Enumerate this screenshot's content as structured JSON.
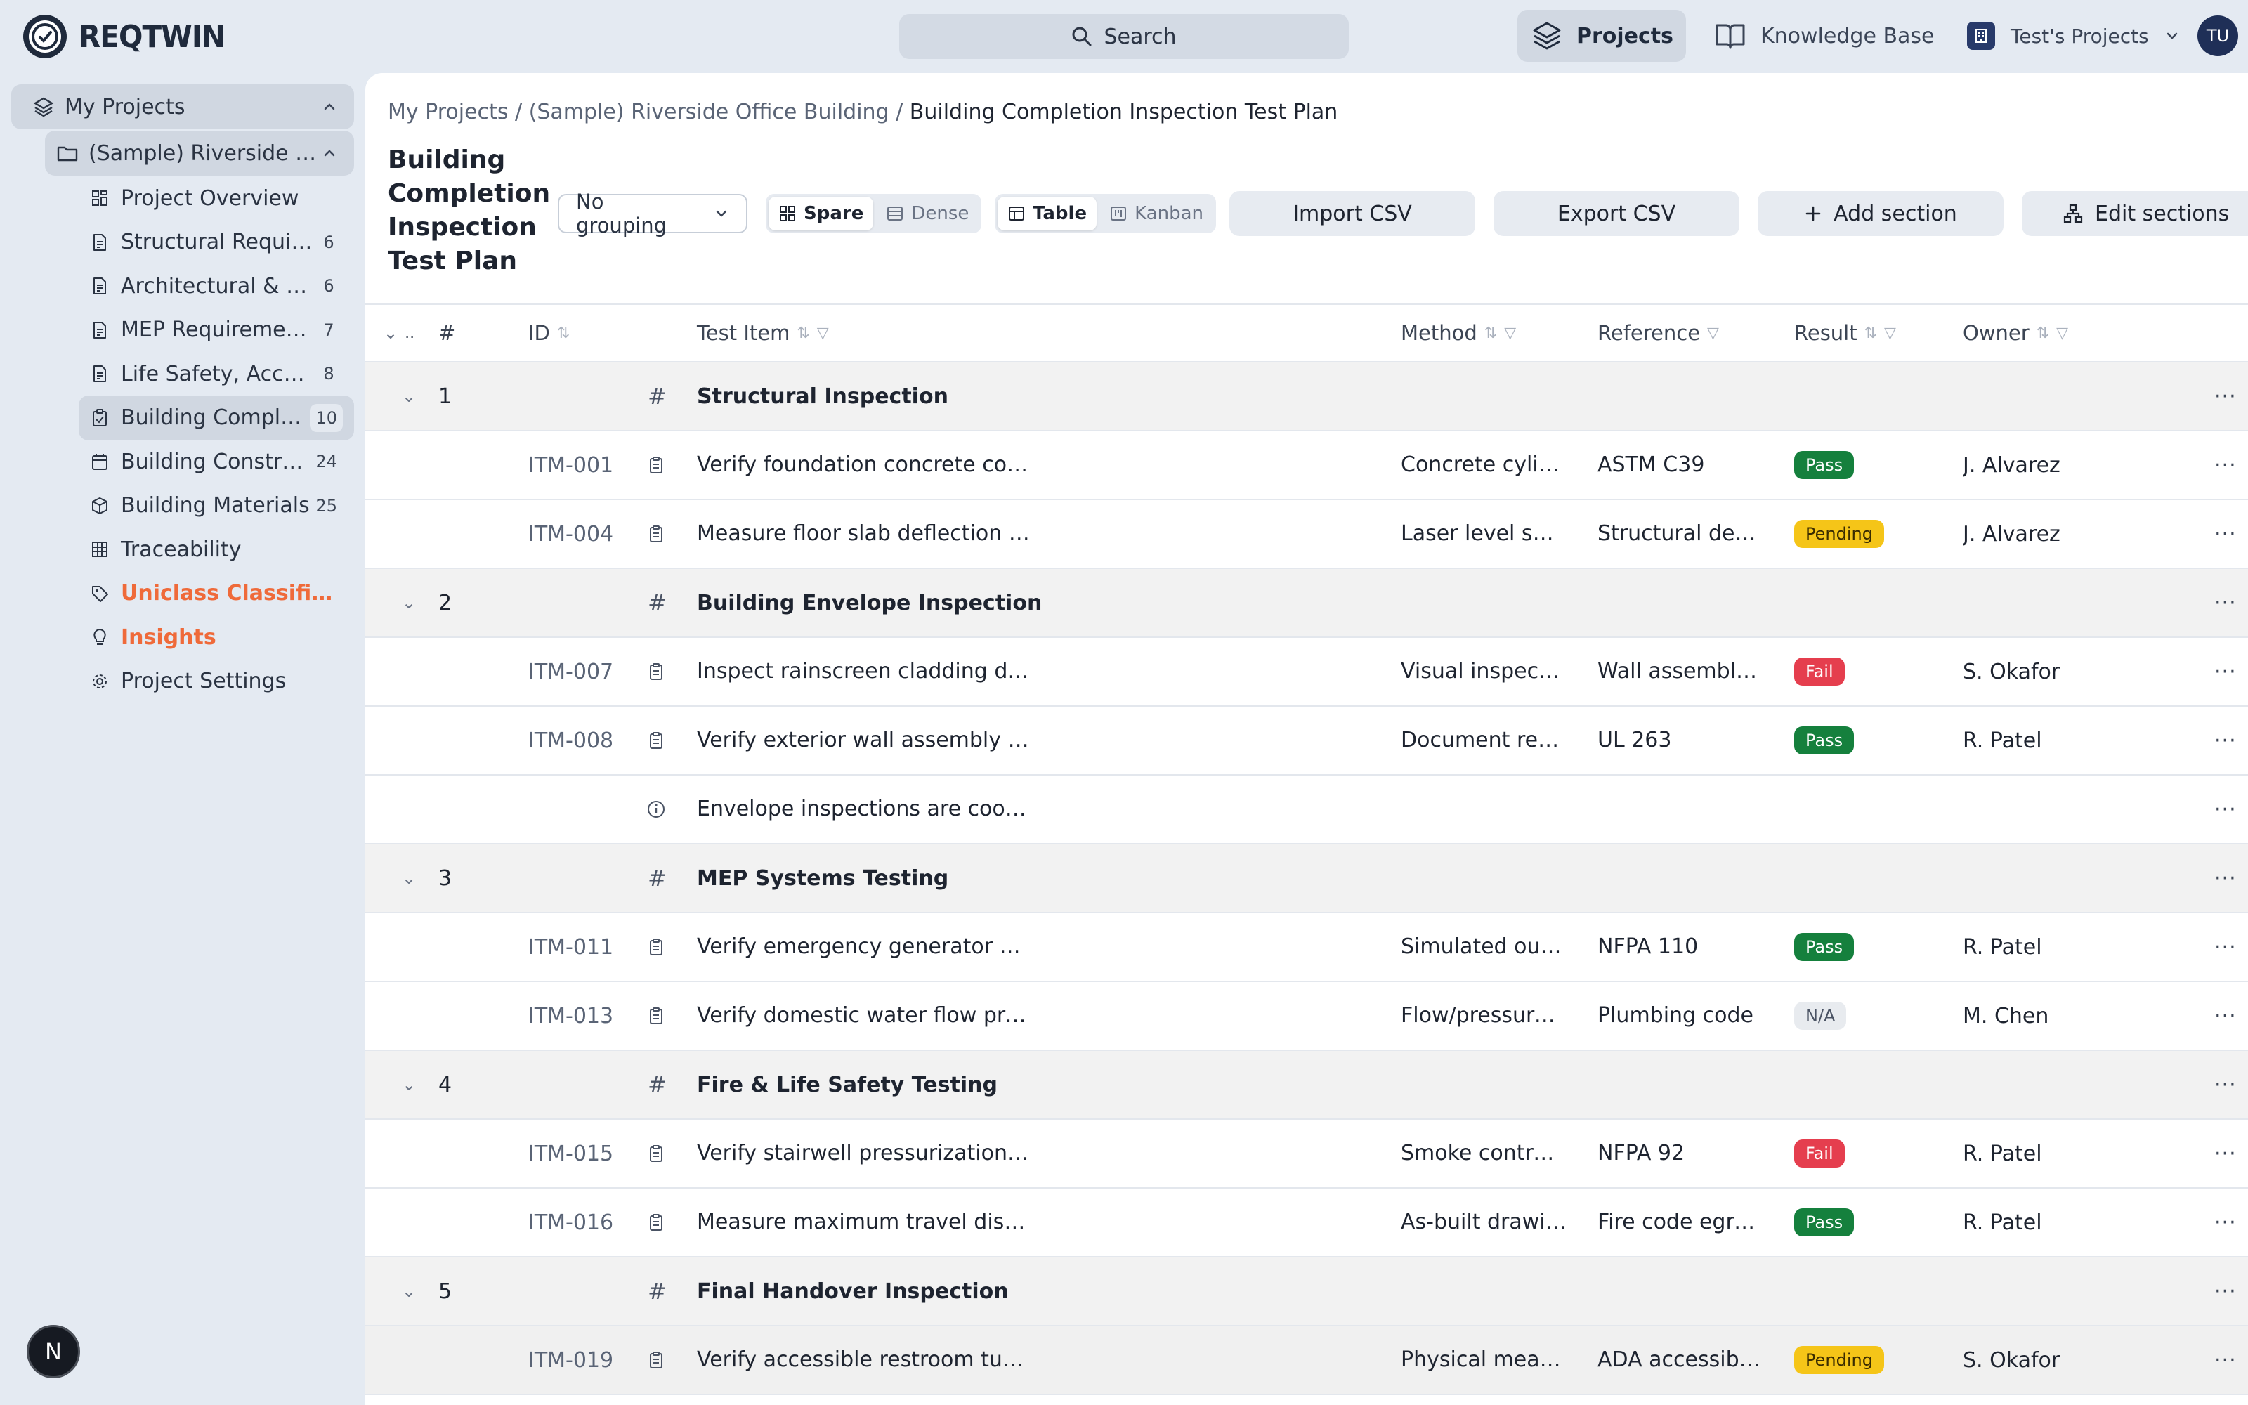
{
  "app": {
    "name": "REQTWIN",
    "search_label": "Search",
    "nav_projects": "Projects",
    "nav_knowledge_base": "Knowledge Base",
    "workspace": "Test's Projects",
    "avatar_initials": "TU",
    "next_badge": "N"
  },
  "sidebar": {
    "root": "My Projects",
    "project": "(Sample) Riverside Office Building",
    "items": [
      {
        "label": "Project Overview",
        "count": "",
        "icon": "grid-icon"
      },
      {
        "label": "Structural Requirements",
        "count": "6",
        "icon": "document-icon"
      },
      {
        "label": "Architectural & Finishes",
        "count": "6",
        "icon": "document-icon"
      },
      {
        "label": "MEP Requirements",
        "count": "7",
        "icon": "document-icon"
      },
      {
        "label": "Life Safety, Accessibility",
        "count": "8",
        "icon": "document-icon"
      },
      {
        "label": "Building Completion Inspection Test Plan",
        "count": "10",
        "icon": "clipboard-icon"
      },
      {
        "label": "Building Construction Schedule",
        "count": "24",
        "icon": "calendar-icon"
      },
      {
        "label": "Building Materials",
        "count": "25",
        "icon": "box-icon"
      },
      {
        "label": "Traceability",
        "count": "",
        "icon": "table-icon"
      },
      {
        "label": "Uniclass Classification",
        "count": "",
        "icon": "tag-icon"
      },
      {
        "label": "Insights",
        "count": "",
        "icon": "lightbulb-icon"
      },
      {
        "label": "Project Settings",
        "count": "",
        "icon": "gear-icon"
      }
    ]
  },
  "breadcrumb": {
    "root": "My Projects",
    "sep": " / ",
    "project": "(Sample) Riverside Office Building",
    "current": "Building Completion Inspection Test Plan"
  },
  "page": {
    "title": "Building Completion Inspection Test Plan"
  },
  "toolbar": {
    "grouping": "No grouping",
    "density_spare": "Spare",
    "density_dense": "Dense",
    "view_table": "Table",
    "view_kanban": "Kanban",
    "import_csv": "Import CSV",
    "export_csv": "Export CSV",
    "add_section": "Add section",
    "edit_sections": "Edit sections"
  },
  "table": {
    "columns": {
      "num": "#",
      "id": "ID",
      "test_item": "Test Item",
      "method": "Method",
      "reference": "Reference",
      "result": "Result",
      "owner": "Owner"
    },
    "rows": [
      {
        "type": "section",
        "num": "1",
        "title": "Structural Inspection"
      },
      {
        "type": "item",
        "id": "ITM-001",
        "test_item": "Verify foundation concrete compressive strength meets 35 MPa via cylinder tests",
        "method": "Concrete cylinder testing",
        "reference": "ASTM C39",
        "result": "Pass",
        "owner": "J. Alvarez"
      },
      {
        "type": "item",
        "id": "ITM-004",
        "test_item": "Measure floor slab deflection under superimposed dead load after formwork removal",
        "method": "Laser level survey",
        "reference": "Structural design drawings",
        "result": "Pending",
        "owner": "J. Alvarez"
      },
      {
        "type": "section",
        "num": "2",
        "title": "Building Envelope Inspection"
      },
      {
        "type": "item",
        "id": "ITM-007",
        "test_item": "Inspect rainscreen cladding drainage cavity clearance behind panels",
        "method": "Visual inspection",
        "reference": "Wall assembly details",
        "result": "Fail",
        "owner": "S. Okafor"
      },
      {
        "type": "item",
        "id": "ITM-008",
        "test_item": "Verify exterior wall assembly fire resistance rating via furnace test reports",
        "method": "Document review",
        "reference": "UL 263",
        "result": "Pass",
        "owner": "R. Patel"
      },
      {
        "type": "note",
        "text": "Envelope inspections are coordinated with the building enclosure consultant"
      },
      {
        "type": "section",
        "num": "3",
        "title": "MEP Systems Testing"
      },
      {
        "type": "item",
        "id": "ITM-011",
        "test_item": "Verify emergency generator provides full standby power within 10 seconds",
        "method": "Simulated outage test",
        "reference": "NFPA 110",
        "result": "Pass",
        "owner": "R. Patel"
      },
      {
        "type": "item",
        "id": "ITM-013",
        "test_item": "Verify domestic water flow pressure at the highest floor fixture under peak demand",
        "method": "Flow/pressure test",
        "reference": "Plumbing code",
        "result": "N/A",
        "owner": "M. Chen"
      },
      {
        "type": "section",
        "num": "4",
        "title": "Fire & Life Safety Testing"
      },
      {
        "type": "item",
        "id": "ITM-015",
        "test_item": "Verify stairwell pressurization differential during a simulated fire event",
        "method": "Smoke control test",
        "reference": "NFPA 92",
        "result": "Fail",
        "owner": "R. Patel"
      },
      {
        "type": "item",
        "id": "ITM-016",
        "test_item": "Measure maximum travel distance from representative occupied spaces to exits",
        "method": "As-built drawing review",
        "reference": "Fire code egress",
        "result": "Pass",
        "owner": "R. Patel"
      },
      {
        "type": "section",
        "num": "5",
        "title": "Final Handover Inspection"
      },
      {
        "type": "item",
        "id": "ITM-019",
        "test_item": "Verify accessible restroom turning radius and fixture clearances on each floor",
        "method": "Physical measurement",
        "reference": "ADA accessibility standards",
        "result": "Pending",
        "owner": "S. Okafor"
      }
    ]
  },
  "colors": {
    "accent": "#ef6a3a",
    "pass": "#15803d",
    "pending": "#f5c518",
    "fail": "#e53e4e"
  }
}
